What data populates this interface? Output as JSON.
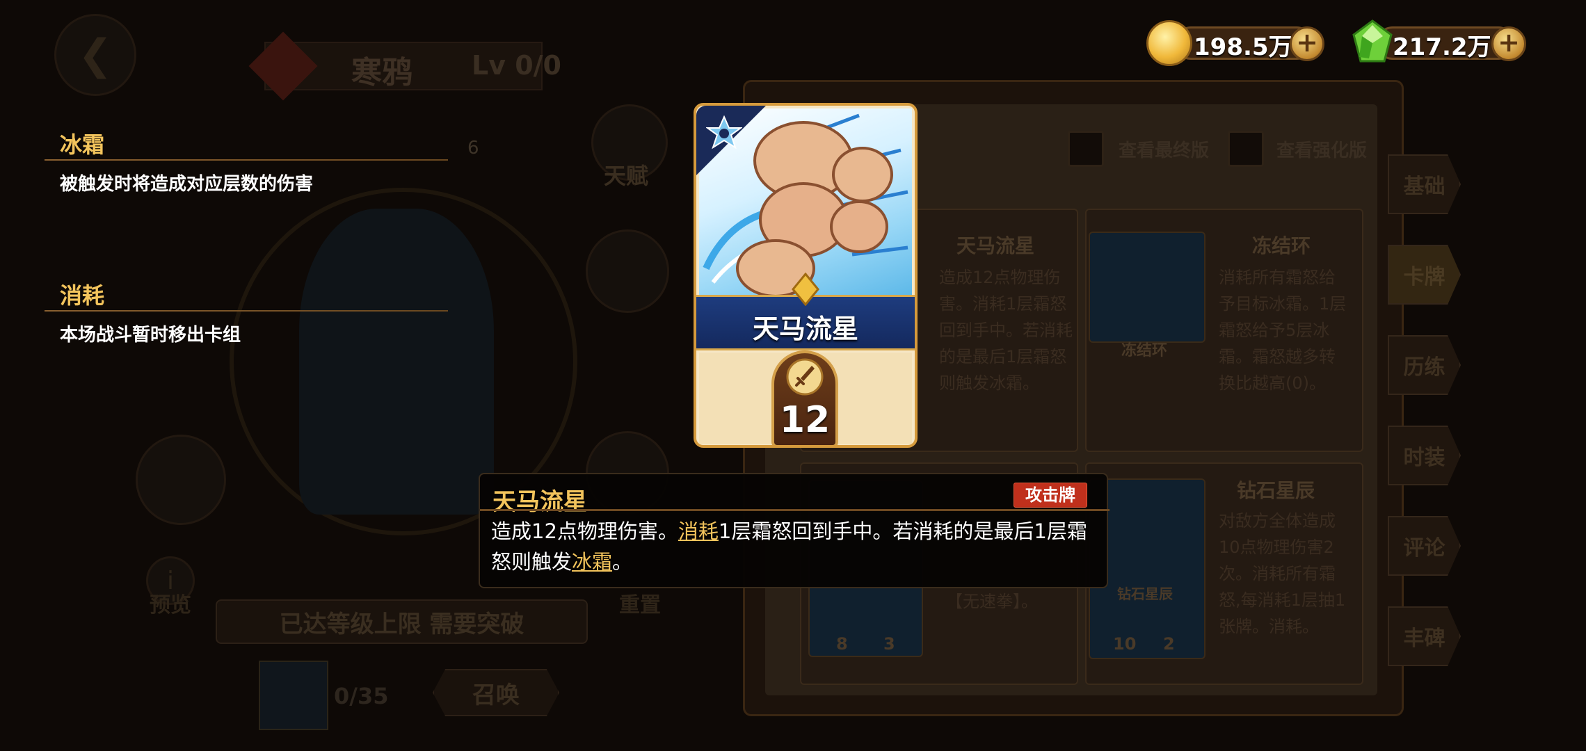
{
  "currencies": {
    "gold": {
      "value": "198.5万",
      "icon": "gold-coin-icon"
    },
    "gems": {
      "value": "217.2万",
      "icon": "green-gem-icon"
    }
  },
  "keywords": [
    {
      "title": "冰霜",
      "desc": "被触发时将造成对应层数的伤害"
    },
    {
      "title": "消耗",
      "desc": "本场战斗暂时移出卡组"
    }
  ],
  "card": {
    "name": "天马流星",
    "cost": "12",
    "type_icon": "star-icon",
    "cost_icon": "sword-icon"
  },
  "tooltip": {
    "title": "天马流星",
    "badge": "攻击牌",
    "text_1": "造成12点物理伤害。",
    "kw_1": "消耗",
    "text_2": "1层霜怒回到手中。若消耗的是最后1层霜怒则触发",
    "kw_2": "冰霜",
    "text_3": "。"
  },
  "background": {
    "hero_name": "寒鸦",
    "hero_level": "Lv 0/0",
    "stat_value": "6",
    "talent_label": "天赋",
    "preview_label": "预览",
    "reset_label": "重置",
    "level_cap_button": "已达等级上限 需要突破",
    "shard_count": "0/35",
    "summon_button": "召唤",
    "check_final": "查看最终版",
    "check_enhanced": "查看强化版",
    "side_tabs": [
      "基础",
      "卡牌",
      "历练",
      "时装",
      "评论",
      "丰碑"
    ],
    "cards": [
      {
        "name": "天马流星",
        "desc": "造成12点物理伤害。消耗1层霜怒回到手中。若消耗的是最后1层霜怒则触发冰霜。"
      },
      {
        "name": "冻结环",
        "art_label": "冻结环",
        "desc": "消耗所有霜怒给予目标冰霜。1层霜怒给予5层冰霜。霜怒越多转换比越高(0)。"
      },
      {
        "name": "钻石星辰",
        "art_label": "钻石星辰",
        "desc": "对敌方全体造成10点物理伤害2次。消耗所有霜怒,每消耗1层抽1张牌。消耗。",
        "cost_a": "10",
        "cost_b": "2"
      },
      {
        "name": "",
        "extra": "【无速拳】。",
        "cost_a": "8",
        "cost_b": "3"
      }
    ]
  }
}
